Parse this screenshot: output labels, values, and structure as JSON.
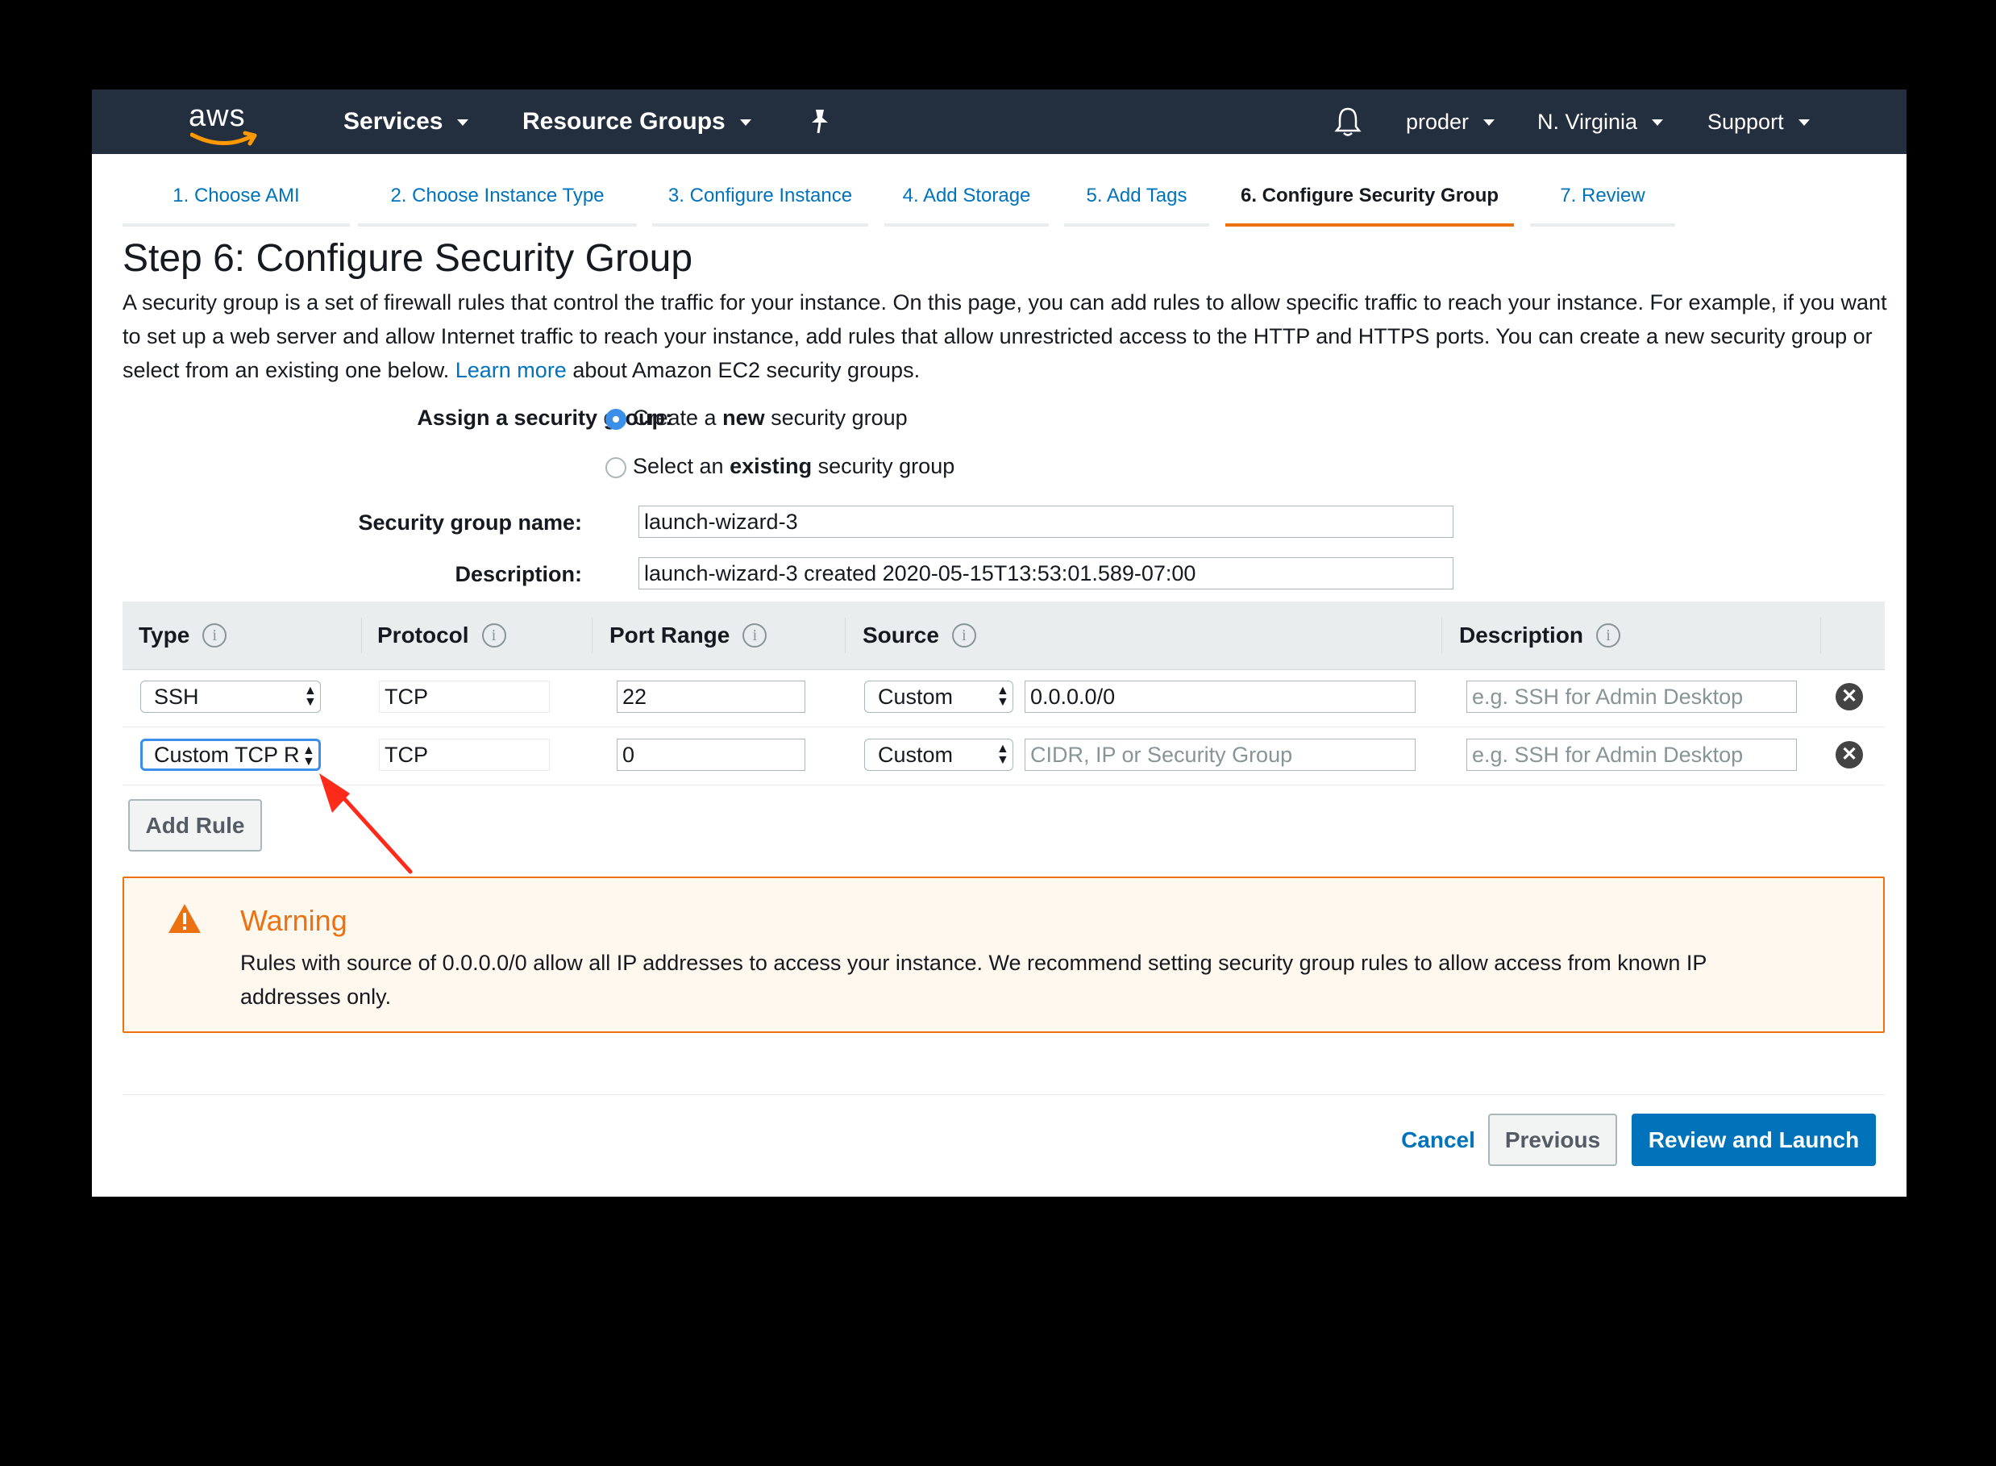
{
  "nav": {
    "logo": "aws",
    "services": "Services",
    "resource_groups": "Resource Groups",
    "pin_icon": "pin-icon",
    "bell_icon": "bell-icon",
    "user": "proder",
    "region": "N. Virginia",
    "support": "Support"
  },
  "tabs": [
    {
      "label": "1. Choose AMI"
    },
    {
      "label": "2. Choose Instance Type"
    },
    {
      "label": "3. Configure Instance"
    },
    {
      "label": "4. Add Storage"
    },
    {
      "label": "5. Add Tags"
    },
    {
      "label": "6. Configure Security Group"
    },
    {
      "label": "7. Review"
    }
  ],
  "active_tab": "6. Configure Security Group",
  "page": {
    "title": "Step 6: Configure Security Group",
    "intro_before_link": "A security group is a set of firewall rules that control the traffic for your instance. On this page, you can add rules to allow specific traffic to reach your instance. For example, if you want to set up a web server and allow Internet traffic to reach your instance, add rules that allow unrestricted access to the HTTP and HTTPS ports. You can create a new security group or select from an existing one below.",
    "learn_more": "Learn more",
    "intro_after_link": "about Amazon EC2 security groups."
  },
  "assign": {
    "label": "Assign a security group:",
    "option_new_pre": "Create a",
    "option_new_bold": "new",
    "option_new_post": "security group",
    "option_existing_pre": "Select an",
    "option_existing_bold": "existing",
    "option_existing_post": "security group",
    "selected": "new"
  },
  "form": {
    "name_label": "Security group name:",
    "name_value": "launch-wizard-3",
    "desc_label": "Description:",
    "desc_value": "launch-wizard-3 created 2020-05-15T13:53:01.589-07:00"
  },
  "table": {
    "headers": {
      "type": "Type",
      "protocol": "Protocol",
      "port_range": "Port Range",
      "source": "Source",
      "description": "Description"
    },
    "info_glyph": "i",
    "rows": [
      {
        "type": "SSH",
        "protocol": "TCP",
        "port_range": "22",
        "source_mode": "Custom",
        "source_value": "0.0.0.0/0",
        "source_placeholder": "CIDR, IP or Security Group",
        "description_placeholder": "e.g. SSH for Admin Desktop"
      },
      {
        "type": "Custom TCP R",
        "protocol": "TCP",
        "port_range": "0",
        "source_mode": "Custom",
        "source_value": "",
        "source_placeholder": "CIDR, IP or Security Group",
        "description_placeholder": "e.g. SSH for Admin Desktop"
      }
    ],
    "remove_glyph": "✕"
  },
  "add_rule": "Add Rule",
  "warning": {
    "title": "Warning",
    "message": "Rules with source of 0.0.0.0/0 allow all IP addresses to access your instance. We recommend setting security group rules to allow access from known IP addresses only."
  },
  "footer": {
    "cancel": "Cancel",
    "previous": "Previous",
    "review": "Review and Launch"
  },
  "colors": {
    "nav_bg": "#232f3e",
    "link": "#0073bb",
    "accent": "#ec7211",
    "primary": "#0073bb",
    "annotation_arrow": "#ff2a1a"
  }
}
